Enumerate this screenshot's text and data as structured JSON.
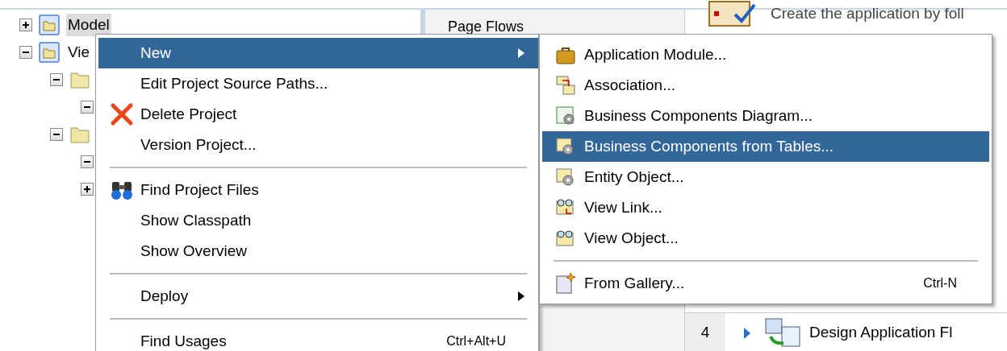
{
  "tree": {
    "items": [
      {
        "label": "Model",
        "selected": true,
        "expanded": false
      },
      {
        "label": "Vie",
        "selected": false,
        "expanded": true,
        "children": [
          {
            "expanded": true,
            "children": [
              {
                "expanded": true
              }
            ]
          },
          {
            "expanded": true,
            "children": [
              {
                "expanded": true
              },
              {
                "expanded": false
              }
            ]
          }
        ]
      }
    ]
  },
  "middle_panel": {
    "heading": "Page Flows"
  },
  "right_panel": {
    "intro": "Create the application by foll",
    "step": {
      "number": "4",
      "label": "Design Application Fl"
    }
  },
  "context_menu": {
    "items": [
      {
        "kind": "item",
        "label": "New",
        "submenu": true,
        "selected": true
      },
      {
        "kind": "item",
        "label": "Edit Project Source Paths...",
        "submenu": false,
        "selected": false
      },
      {
        "kind": "item",
        "label": "Delete Project",
        "submenu": false,
        "selected": false
      },
      {
        "kind": "item",
        "label": "Version Project...",
        "submenu": false,
        "selected": false
      },
      {
        "kind": "separator"
      },
      {
        "kind": "item",
        "label": "Find Project Files",
        "submenu": false,
        "selected": false
      },
      {
        "kind": "item",
        "label": "Show Classpath",
        "submenu": false,
        "selected": false
      },
      {
        "kind": "item",
        "label": "Show Overview",
        "submenu": false,
        "selected": false
      },
      {
        "kind": "separator"
      },
      {
        "kind": "item",
        "label": "Deploy",
        "submenu": true,
        "selected": false
      },
      {
        "kind": "separator"
      },
      {
        "kind": "item",
        "label": "Find Usages",
        "submenu": false,
        "selected": false,
        "shortcut": "Ctrl+Alt+U"
      }
    ]
  },
  "submenu": {
    "items": [
      {
        "kind": "item",
        "label": "Application Module...",
        "selected": false
      },
      {
        "kind": "item",
        "label": "Association...",
        "selected": false
      },
      {
        "kind": "item",
        "label": "Business Components Diagram...",
        "selected": false
      },
      {
        "kind": "item",
        "label": "Business Components from Tables...",
        "selected": true
      },
      {
        "kind": "item",
        "label": "Entity Object...",
        "selected": false
      },
      {
        "kind": "item",
        "label": "View Link...",
        "selected": false
      },
      {
        "kind": "item",
        "label": "View Object...",
        "selected": false
      },
      {
        "kind": "separator"
      },
      {
        "kind": "item",
        "label": "From Gallery...",
        "selected": false,
        "shortcut": "Ctrl-N"
      }
    ]
  }
}
